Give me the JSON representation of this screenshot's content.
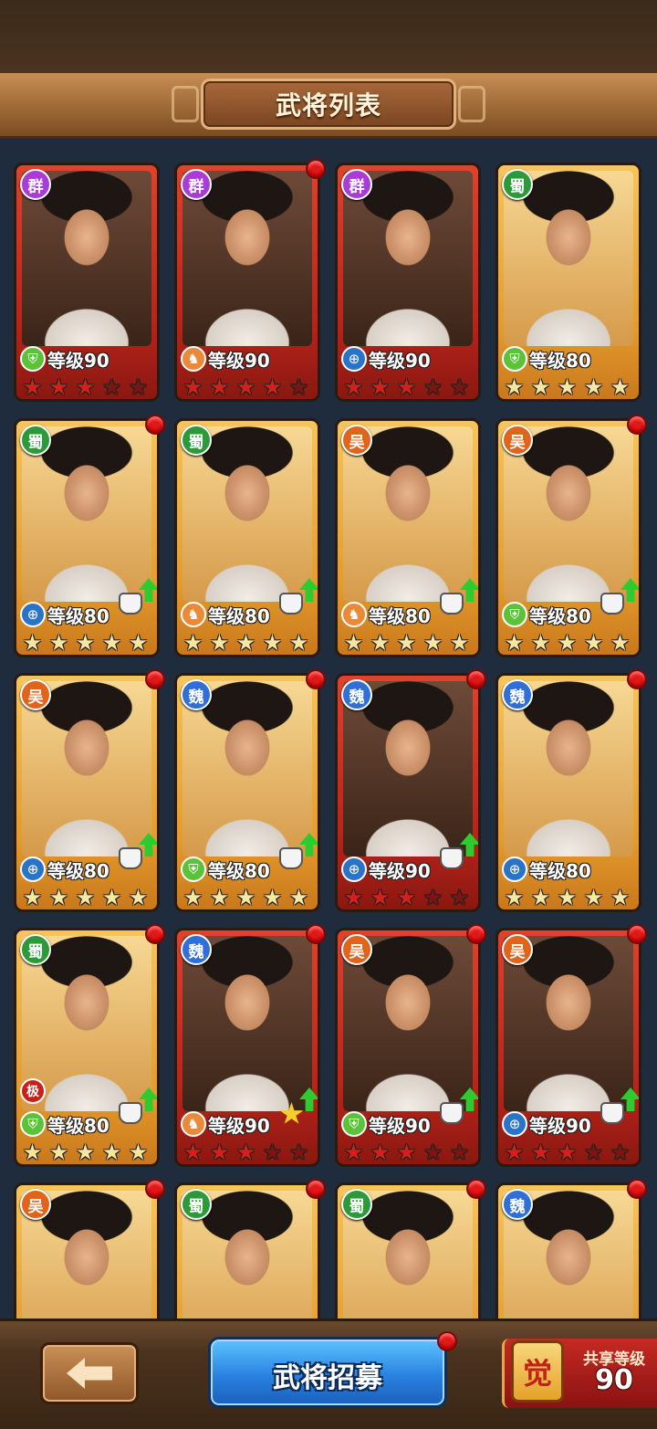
{
  "header": {
    "title": "武将列表"
  },
  "factions": {
    "qun": "群",
    "shu": "蜀",
    "wu": "吴",
    "wei": "魏"
  },
  "generals": [
    {
      "faction": "群",
      "faction_key": "qun",
      "frame": "red",
      "class": "shield-icon",
      "level_text": "等级90",
      "stars": 3,
      "red_dot": false,
      "upgrade": false,
      "equip": "none"
    },
    {
      "faction": "群",
      "faction_key": "qun",
      "frame": "red",
      "class": "horse-icon",
      "level_text": "等级90",
      "stars": 4,
      "red_dot": true,
      "upgrade": false,
      "equip": "none"
    },
    {
      "faction": "群",
      "faction_key": "qun",
      "frame": "red",
      "class": "bow-icon",
      "level_text": "等级90",
      "stars": 3,
      "red_dot": false,
      "upgrade": false,
      "equip": "none"
    },
    {
      "faction": "蜀",
      "faction_key": "shu",
      "frame": "gold",
      "class": "shield-icon",
      "level_text": "等级80",
      "stars": 5,
      "red_dot": false,
      "upgrade": false,
      "equip": "none"
    },
    {
      "faction": "蜀",
      "faction_key": "shu",
      "frame": "gold",
      "class": "bow-icon",
      "level_text": "等级80",
      "stars": 5,
      "red_dot": true,
      "upgrade": true,
      "equip": "armor"
    },
    {
      "faction": "蜀",
      "faction_key": "shu",
      "frame": "gold",
      "class": "horse-icon",
      "level_text": "等级80",
      "stars": 5,
      "red_dot": false,
      "upgrade": true,
      "equip": "armor"
    },
    {
      "faction": "吴",
      "faction_key": "wu",
      "frame": "gold",
      "class": "horse-icon",
      "level_text": "等级80",
      "stars": 5,
      "red_dot": false,
      "upgrade": true,
      "equip": "armor"
    },
    {
      "faction": "吴",
      "faction_key": "wu",
      "frame": "gold",
      "class": "shield-icon",
      "level_text": "等级80",
      "stars": 5,
      "red_dot": true,
      "upgrade": true,
      "equip": "armor"
    },
    {
      "faction": "吴",
      "faction_key": "wu",
      "frame": "gold",
      "class": "bow-icon",
      "level_text": "等级80",
      "stars": 5,
      "red_dot": true,
      "upgrade": true,
      "equip": "armor"
    },
    {
      "faction": "魏",
      "faction_key": "wei",
      "frame": "gold",
      "class": "shield-icon",
      "level_text": "等级80",
      "stars": 5,
      "red_dot": true,
      "upgrade": true,
      "equip": "armor"
    },
    {
      "faction": "魏",
      "faction_key": "wei",
      "frame": "red",
      "class": "bow-icon",
      "level_text": "等级90",
      "stars": 3,
      "red_dot": true,
      "upgrade": true,
      "equip": "armor"
    },
    {
      "faction": "魏",
      "faction_key": "wei",
      "frame": "gold",
      "class": "bow-icon",
      "level_text": "等级80",
      "stars": 5,
      "red_dot": true,
      "upgrade": false,
      "equip": "none"
    },
    {
      "faction": "蜀",
      "faction_key": "shu",
      "frame": "gold",
      "class": "shield-icon",
      "level_text": "等级80",
      "stars": 5,
      "red_dot": true,
      "upgrade": true,
      "equip": "armor",
      "badge": "极"
    },
    {
      "faction": "魏",
      "faction_key": "wei",
      "frame": "red",
      "class": "horse-icon",
      "level_text": "等级90",
      "stars": 3,
      "red_dot": true,
      "upgrade": true,
      "equip": "star"
    },
    {
      "faction": "吴",
      "faction_key": "wu",
      "frame": "red",
      "class": "shield-icon",
      "level_text": "等级90",
      "stars": 3,
      "red_dot": true,
      "upgrade": true,
      "equip": "armor"
    },
    {
      "faction": "吴",
      "faction_key": "wu",
      "frame": "red",
      "class": "bow-icon",
      "level_text": "等级90",
      "stars": 3,
      "red_dot": true,
      "upgrade": true,
      "equip": "armor"
    },
    {
      "faction": "吴",
      "faction_key": "wu",
      "frame": "gold",
      "class": "",
      "level_text": "",
      "stars": 0,
      "red_dot": true,
      "upgrade": false,
      "equip": "none"
    },
    {
      "faction": "蜀",
      "faction_key": "shu",
      "frame": "gold",
      "class": "",
      "level_text": "",
      "stars": 0,
      "red_dot": true,
      "upgrade": false,
      "equip": "none"
    },
    {
      "faction": "蜀",
      "faction_key": "shu",
      "frame": "gold",
      "class": "",
      "level_text": "",
      "stars": 0,
      "red_dot": true,
      "upgrade": false,
      "equip": "none"
    },
    {
      "faction": "魏",
      "faction_key": "wei",
      "frame": "gold",
      "class": "",
      "level_text": "",
      "stars": 0,
      "red_dot": true,
      "upgrade": false,
      "equip": "none"
    }
  ],
  "bottom": {
    "recruit_label": "武将招募",
    "shared_icon_text": "觉",
    "shared_label": "共享等级",
    "shared_value": "90"
  }
}
